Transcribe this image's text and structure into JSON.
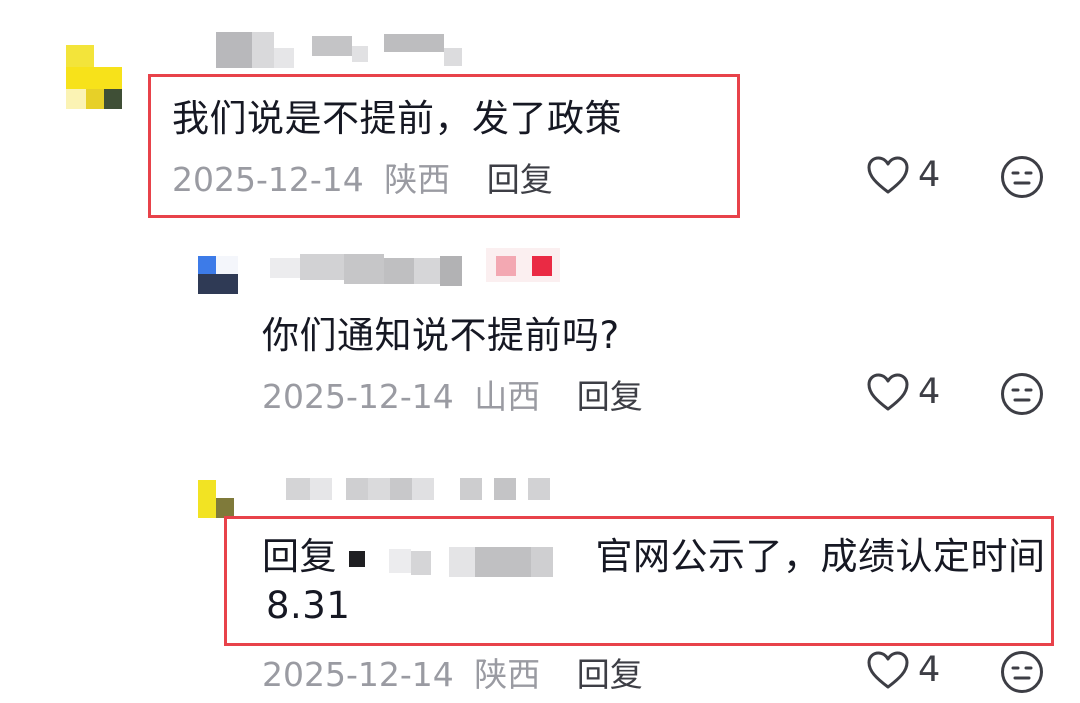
{
  "comments": [
    {
      "text": "我们说是不提前，发了政策",
      "date": "2025-12-14",
      "location": "陕西",
      "reply_label": "回复",
      "likes": "4"
    },
    {
      "text": "你们通知说不提前吗?",
      "date": "2025-12-14",
      "location": "山西",
      "reply_label": "回复",
      "likes": "4"
    },
    {
      "reply_prefix": "回复",
      "text": "官网公示了，成绩认定时间",
      "text_line2": "8.31",
      "date": "2025-12-14",
      "location": "陕西",
      "reply_label": "回复",
      "likes": "4"
    }
  ],
  "icons": {
    "like": "heart-outline-icon",
    "reaction": "neutral-face-icon"
  },
  "colors": {
    "highlight": "#e8424a",
    "meta_text": "#9a9ba2",
    "body_text": "#161823"
  }
}
